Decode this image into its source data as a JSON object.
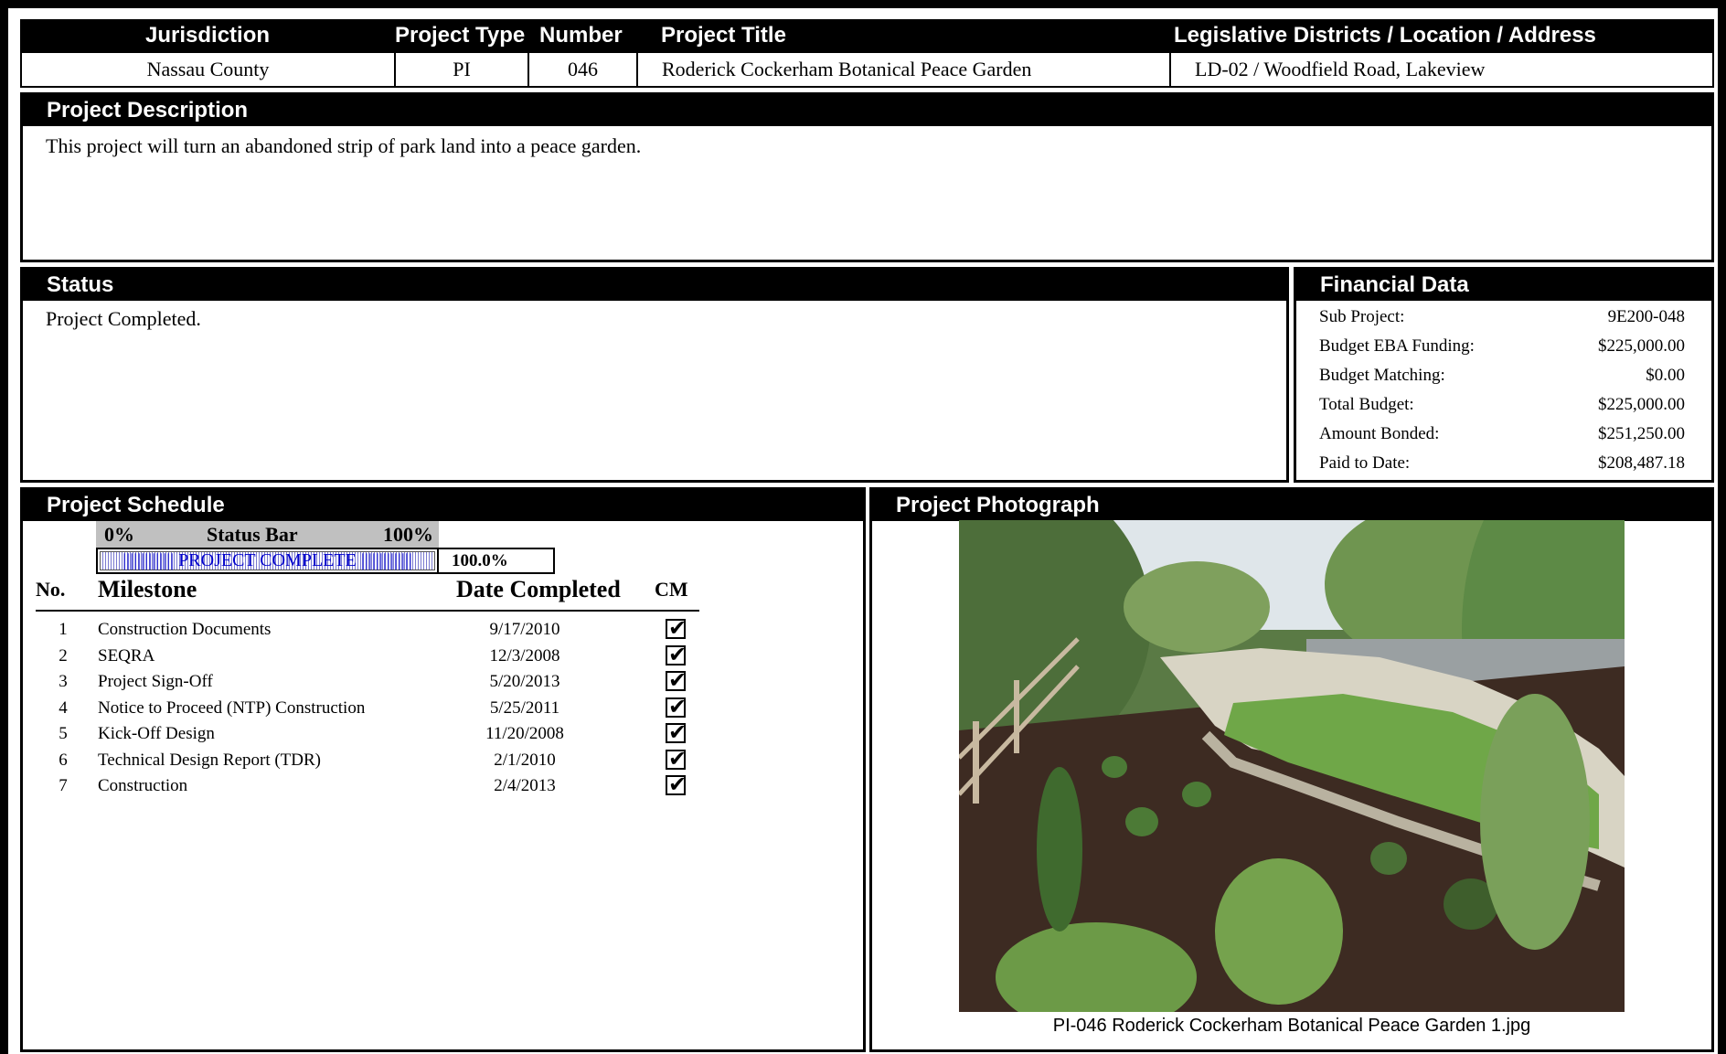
{
  "header": {
    "col_jurisdiction": "Jurisdiction",
    "col_project_type": "Project Type",
    "col_number": "Number",
    "col_project_title": "Project Title",
    "col_location": "Legislative Districts / Location / Address",
    "jurisdiction": "Nassau County",
    "project_type": "PI",
    "number": "046",
    "project_title": "Roderick Cockerham Botanical Peace Garden",
    "location": "LD-02 / Woodfield Road, Lakeview"
  },
  "description": {
    "title": "Project Description",
    "text": "This project will turn an abandoned strip of park land into a peace garden."
  },
  "status": {
    "title": "Status",
    "text": "Project Completed."
  },
  "financial": {
    "title": "Financial Data",
    "rows": [
      {
        "label": "Sub Project:",
        "value": "9E200-048"
      },
      {
        "label": "Budget EBA Funding:",
        "value": "$225,000.00"
      },
      {
        "label": "Budget Matching:",
        "value": "$0.00"
      },
      {
        "label": "Total Budget:",
        "value": "$225,000.00"
      },
      {
        "label": "Amount Bonded:",
        "value": "$251,250.00"
      },
      {
        "label": "Paid to Date:",
        "value": "$208,487.18"
      }
    ]
  },
  "schedule": {
    "title": "Project Schedule",
    "statusbar": {
      "min_label": "0%",
      "label": "Status Bar",
      "max_label": "100%",
      "bar_text": "|||||||||||||| PROJECT COMPLETE ||||||||||||||",
      "percent_text": "100.0%",
      "progress": 1.0
    },
    "columns": {
      "no": "No.",
      "milestone": "Milestone",
      "date": "Date Completed",
      "cm": "CM"
    },
    "check_glyph": "✔",
    "rows": [
      {
        "no": "1",
        "milestone": "Construction Documents",
        "date": "9/17/2010"
      },
      {
        "no": "2",
        "milestone": "SEQRA",
        "date": "12/3/2008"
      },
      {
        "no": "3",
        "milestone": "Project Sign-Off",
        "date": "5/20/2013"
      },
      {
        "no": "4",
        "milestone": "Notice to Proceed (NTP) Construction",
        "date": "5/25/2011"
      },
      {
        "no": "5",
        "milestone": "Kick-Off Design",
        "date": "11/20/2008"
      },
      {
        "no": "6",
        "milestone": "Technical Design Report (TDR)",
        "date": "2/1/2010"
      },
      {
        "no": "7",
        "milestone": "Construction",
        "date": "2/4/2013"
      }
    ]
  },
  "photo": {
    "title": "Project Photograph",
    "caption": "PI-046 Roderick Cockerham Botanical Peace Garden 1.jpg"
  },
  "colors": {
    "header_bg": "#000000",
    "bar_text": "#0000cc",
    "statusbar_bg": "#c0c0c0"
  }
}
